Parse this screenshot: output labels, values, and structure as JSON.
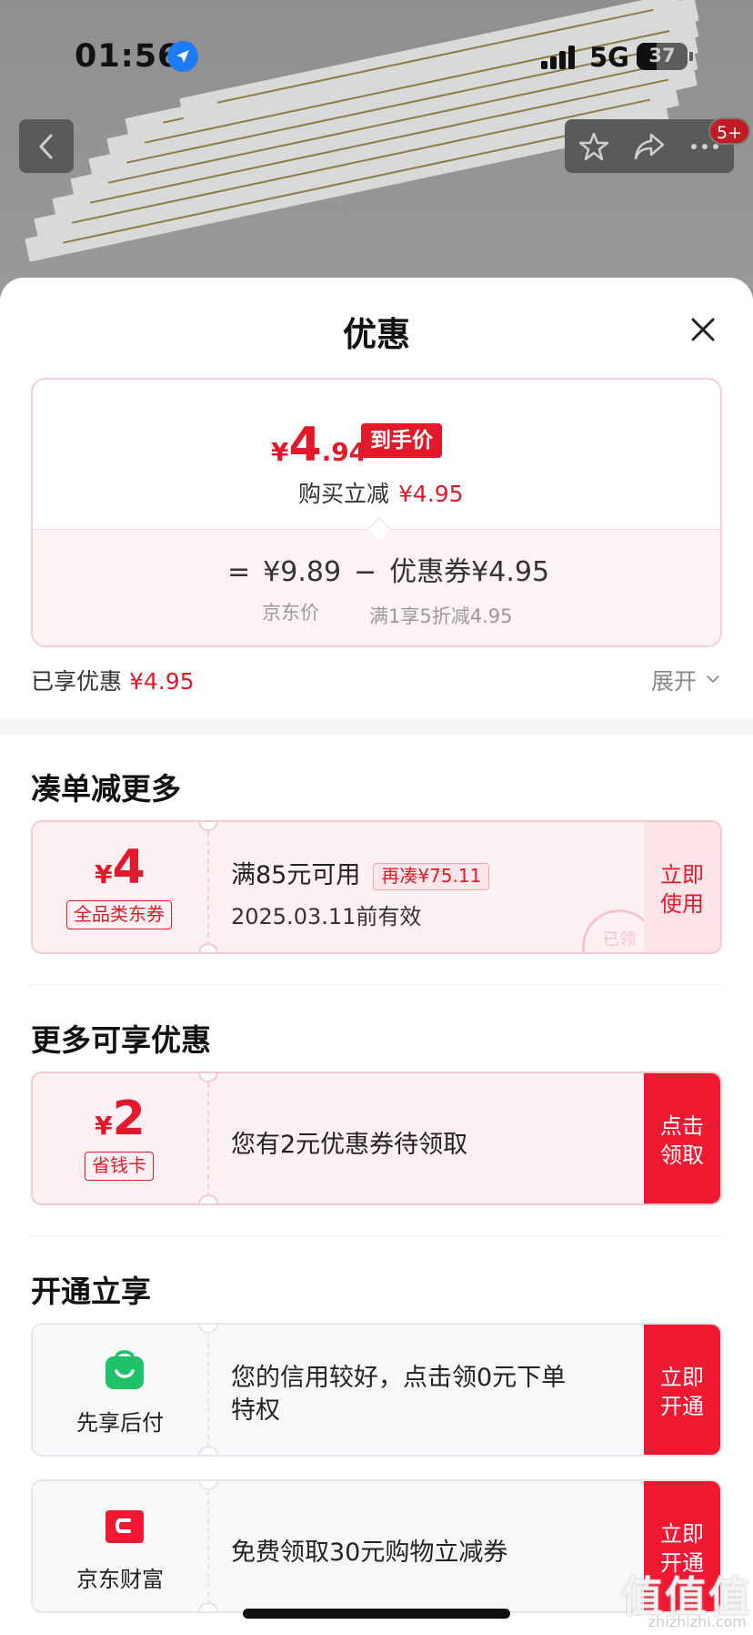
{
  "status_bar": {
    "time": "01:56",
    "network": "5G",
    "battery": "37"
  },
  "top_bar": {
    "notification_badge": "5+"
  },
  "sheet": {
    "title": "优惠",
    "price_card": {
      "final_price_yen": "¥",
      "final_price_int": "4",
      "final_price_dec": ".94",
      "final_tag": "到手价",
      "instant_label": "购买立减",
      "instant_value": "¥4.95",
      "formula_eq": "=",
      "formula_jd": "¥9.89",
      "formula_minus": "−",
      "formula_coupon": "优惠券¥4.95",
      "jd_price_label": "京东价",
      "coupon_rule": "满1享5折减4.95"
    },
    "enjoyed_label": "已享优惠",
    "enjoyed_value": "¥4.95",
    "expand_label": "展开"
  },
  "section_more_order": {
    "title": "凑单减更多",
    "coupon": {
      "yen": "¥",
      "amount": "4",
      "tag": "全品类东券",
      "condition": "满85元可用",
      "need": "再凑¥75.11",
      "valid": "2025.03.11前有效",
      "action": "立即使用",
      "stamp": "已领"
    }
  },
  "section_more_discount": {
    "title": "更多可享优惠",
    "coupon": {
      "yen": "¥",
      "amount": "2",
      "tag": "省钱卡",
      "desc": "您有2元优惠券待领取",
      "action": "点击领取"
    }
  },
  "section_open": {
    "title": "开通立享",
    "items": [
      {
        "label": "先享后付",
        "desc_line1": "您的信用较好，点击领0元下单",
        "desc_line2": "特权",
        "action": "立即开通",
        "icon": "green-bag-icon"
      },
      {
        "label": "京东财富",
        "desc_line1": "免费领取30元购物立减券",
        "action": "立即开通",
        "icon": "red-wallet-icon"
      }
    ]
  },
  "watermark": {
    "text": "值值值",
    "sub": "zhizhizhi.com"
  },
  "colors": {
    "accent_red": "#e1192a",
    "button_red": "#ef1931",
    "green": "#1fc16a"
  }
}
